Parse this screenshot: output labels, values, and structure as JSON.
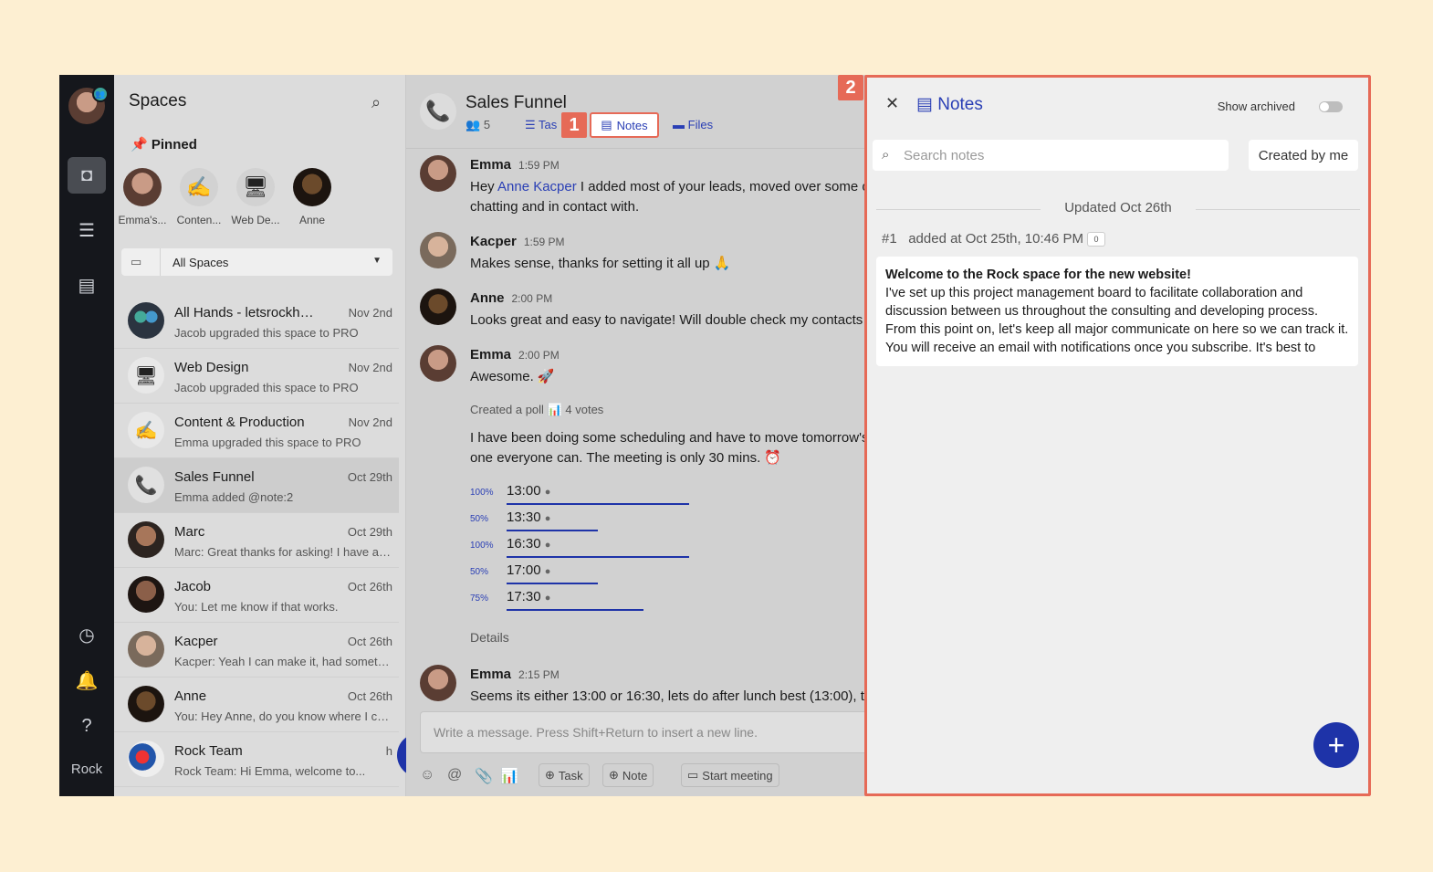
{
  "rail": {
    "brand": "Rock"
  },
  "spaces": {
    "title": "Spaces",
    "pinned_label": "Pinned",
    "pinned": [
      {
        "name": "Emma's..."
      },
      {
        "name": "Conten..."
      },
      {
        "name": "Web De..."
      },
      {
        "name": "Anne"
      }
    ],
    "filter": "All Spaces",
    "items": [
      {
        "title": "All Hands - letsrockhq....",
        "date": "Nov 2nd",
        "sub": "Jacob upgraded this space to PRO"
      },
      {
        "title": "Web Design",
        "date": "Nov 2nd",
        "sub": "Jacob upgraded this space to PRO"
      },
      {
        "title": "Content & Production",
        "date": "Nov 2nd",
        "sub": "Emma upgraded this space to PRO"
      },
      {
        "title": "Sales Funnel",
        "date": "Oct 29th",
        "sub": "Emma added @note:2"
      },
      {
        "title": "Marc",
        "date": "Oct 29th",
        "sub": "Marc: Great thanks for asking! I have a q..."
      },
      {
        "title": "Jacob",
        "date": "Oct 26th",
        "sub": "You: Let me know if that works."
      },
      {
        "title": "Kacper",
        "date": "Oct 26th",
        "sub": "Kacper: Yeah I can make it, had somethi..."
      },
      {
        "title": "Anne",
        "date": "Oct 26th",
        "sub": "You: Hey Anne, do you know where I can..."
      },
      {
        "title": "Rock Team",
        "date": "h",
        "sub": "Rock Team: Hi Emma, welcome to..."
      }
    ]
  },
  "chat": {
    "title": "Sales Funnel",
    "members": "5",
    "tabs": {
      "tasks": "Tas",
      "notes": "Notes",
      "files": "Files"
    },
    "messages": [
      {
        "author": "Emma",
        "time": "1:59 PM",
        "pre": "Hey ",
        "mention": "Anne Kacper",
        "text": " I added most of your leads, moved over some o",
        "text2": "chatting and in contact with."
      },
      {
        "author": "Kacper",
        "time": "1:59 PM",
        "text": "Makes sense, thanks for setting it all up 🙏"
      },
      {
        "author": "Anne",
        "time": "2:00 PM",
        "text": "Looks great and easy to navigate! Will double check my contacts"
      },
      {
        "author": "Emma",
        "time": "2:00 PM",
        "text": "Awesome. 🚀"
      },
      {
        "author": "Emma",
        "time": "2:15 PM",
        "text": "Seems its either 13:00 or 16:30, lets do after lunch best (13:00), tl"
      }
    ],
    "poll": {
      "created": "Created a poll",
      "votes": "4 votes",
      "question": "I have been doing some scheduling and have to move tomorrow's",
      "question2": "one everyone can. The meeting is only 30 mins. ⏰",
      "options": [
        {
          "pct": "100%",
          "label": "13:00",
          "share": 1.0
        },
        {
          "pct": "50%",
          "label": "13:30",
          "share": 0.5
        },
        {
          "pct": "100%",
          "label": "16:30",
          "share": 1.0
        },
        {
          "pct": "50%",
          "label": "17:00",
          "share": 0.5
        },
        {
          "pct": "75%",
          "label": "17:30",
          "share": 0.75
        }
      ]
    },
    "details": "Details",
    "composer_placeholder": "Write a message. Press Shift+Return to insert a new line.",
    "tools": {
      "task": "Task",
      "note": "Note",
      "meeting": "Start meeting"
    }
  },
  "notes": {
    "title": "Notes",
    "show_archived": "Show archived",
    "search_placeholder": "Search notes",
    "filter_button": "Created by me",
    "group_header": "Updated Oct 26th",
    "note": {
      "number": "#1",
      "added": "added at Oct 25th, 10:46 PM",
      "comments": "0",
      "title": "Welcome to the Rock space for the new website!",
      "body": "I've set up this project management board to facilitate collaboration and discussion between us throughout the consulting and developing process. From this point on, let's keep all major communicate on here so we can track it. You will receive an email with notifications once you subscribe. It's best to"
    }
  },
  "callouts": {
    "one": "1",
    "two": "2"
  },
  "colors": {
    "accent": "#1e33a8",
    "callout": "#e66a57",
    "background": "#fdefd2"
  }
}
